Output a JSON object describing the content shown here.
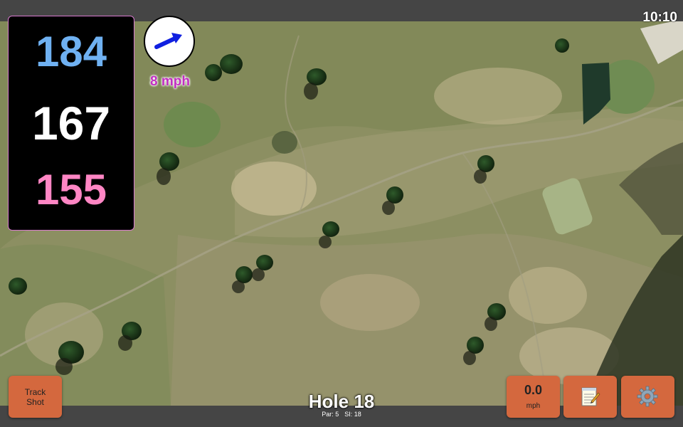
{
  "status_bar": {
    "time": "10:10"
  },
  "distances": {
    "back": "184",
    "middle": "167",
    "front": "155"
  },
  "wind": {
    "speed": "8 mph",
    "icon": "wind-arrow-icon"
  },
  "track_shot": {
    "line1": "Track",
    "line2": "Shot"
  },
  "hole": {
    "title": "Hole 18",
    "par": "Par: 5",
    "si": "SI: 18"
  },
  "speed": {
    "value": "0.0",
    "unit": "mph"
  },
  "notes": {
    "icon": "notepad-icon"
  },
  "settings": {
    "icon": "gear-icon"
  },
  "colors": {
    "back_distance": "#6fb1f2",
    "middle_distance": "#ffffff",
    "front_distance": "#ff86c4",
    "button": "#d4683e",
    "wind_text": "#c22fc2",
    "wind_arrow": "#1020e0"
  }
}
